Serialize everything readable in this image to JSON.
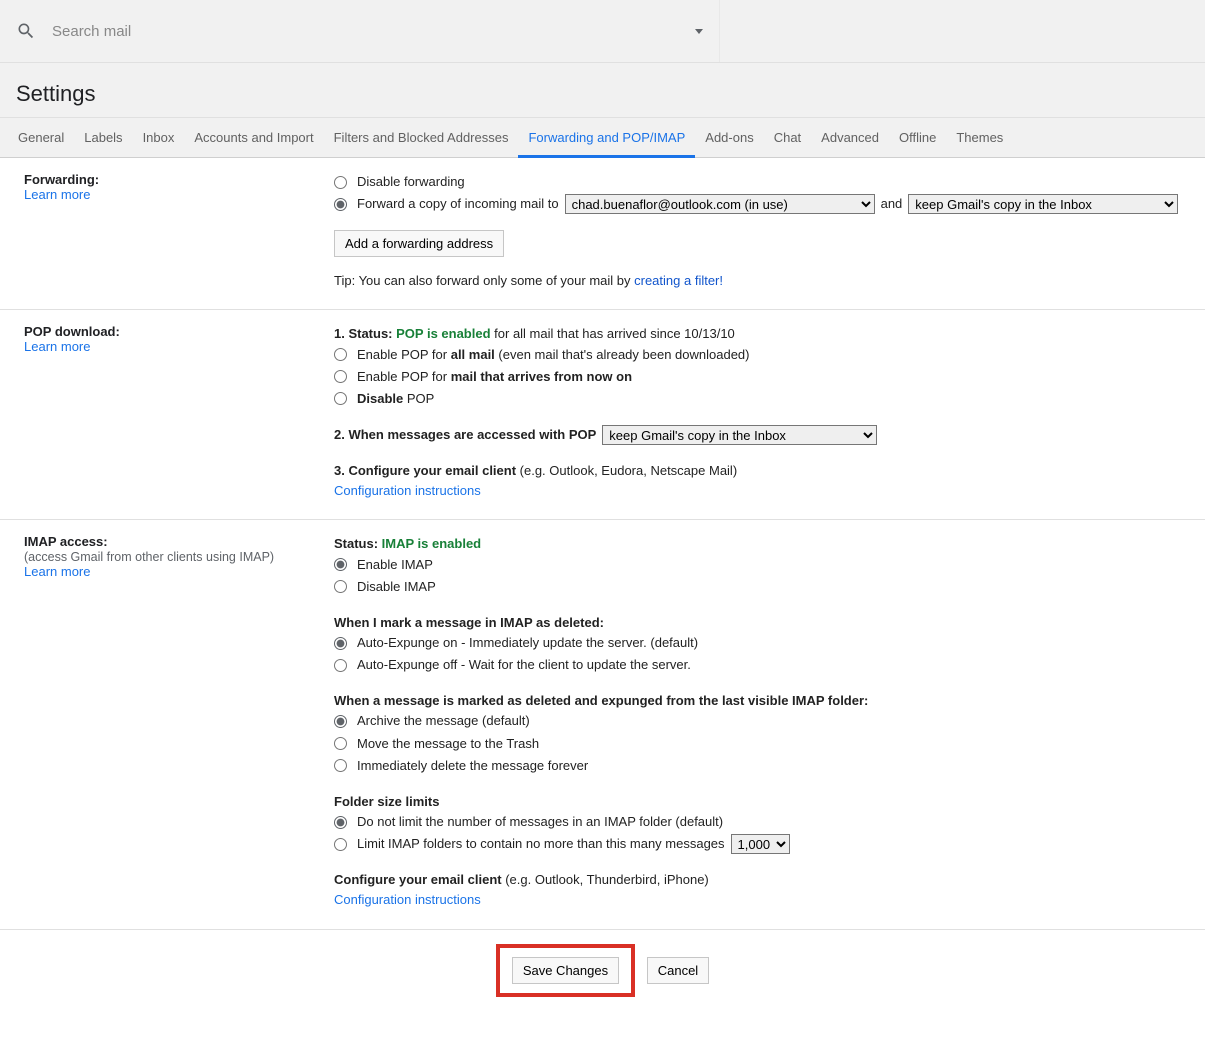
{
  "search": {
    "placeholder": "Search mail"
  },
  "pageTitle": "Settings",
  "tabs": [
    "General",
    "Labels",
    "Inbox",
    "Accounts and Import",
    "Filters and Blocked Addresses",
    "Forwarding and POP/IMAP",
    "Add-ons",
    "Chat",
    "Advanced",
    "Offline",
    "Themes"
  ],
  "learnMore": "Learn more",
  "forwarding": {
    "title": "Forwarding:",
    "disable": "Disable forwarding",
    "forwardCopy": "Forward a copy of incoming mail to",
    "destSelected": "chad.buenaflor@outlook.com (in use)",
    "and": "and",
    "actionSelected": "keep Gmail's copy in the Inbox",
    "addBtn": "Add a forwarding address",
    "tipPre": "Tip: You can also forward only some of your mail by ",
    "tipLink": "creating a filter!"
  },
  "pop": {
    "title": "POP download:",
    "s1a": "1. Status: ",
    "s1b": "POP is enabled",
    "s1c": " for all mail that has arrived since 10/13/10",
    "enableAllPre": "Enable POP for ",
    "enableAllBold": "all mail",
    "enableAllPost": " (even mail that's already been downloaded)",
    "enableNowPre": "Enable POP for ",
    "enableNowBold": "mail that arrives from now on",
    "disablePre": "Disable",
    "disablePost": " POP",
    "s2": "2. When messages are accessed with POP",
    "s2sel": "keep Gmail's copy in the Inbox",
    "s3a": "3. Configure your email client",
    "s3b": " (e.g. Outlook, Eudora, Netscape Mail)",
    "cfgLink": "Configuration instructions"
  },
  "imap": {
    "title": "IMAP access:",
    "sub": "(access Gmail from other clients using IMAP)",
    "statusLabel": "Status: ",
    "statusValue": "IMAP is enabled",
    "enable": "Enable IMAP",
    "disable": "Disable IMAP",
    "delHead": "When I mark a message in IMAP as deleted:",
    "delOn": "Auto-Expunge on - Immediately update the server. (default)",
    "delOff": "Auto-Expunge off - Wait for the client to update the server.",
    "expHead": "When a message is marked as deleted and expunged from the last visible IMAP folder:",
    "expArchive": "Archive the message (default)",
    "expTrash": "Move the message to the Trash",
    "expDelete": "Immediately delete the message forever",
    "sizeHead": "Folder size limits",
    "sizeNoLimit": "Do not limit the number of messages in an IMAP folder (default)",
    "sizeLimitPre": "Limit IMAP folders to contain no more than this many messages",
    "sizeSel": "1,000",
    "cfgA": "Configure your email client",
    "cfgB": " (e.g. Outlook, Thunderbird, iPhone)",
    "cfgLink": "Configuration instructions"
  },
  "actions": {
    "save": "Save Changes",
    "cancel": "Cancel"
  }
}
